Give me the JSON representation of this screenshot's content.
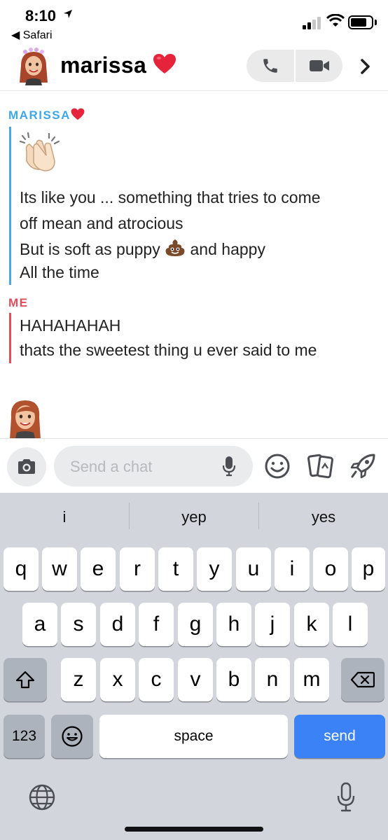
{
  "status_bar": {
    "time": "8:10",
    "back_app": "◀ Safari"
  },
  "header": {
    "contact_name": "marissa",
    "phone_icon": "phone-icon",
    "video_icon": "video-camera-icon",
    "chevron_icon": "chevron-right-icon"
  },
  "conversation": {
    "blocks": [
      {
        "sender": "MARISSA",
        "color": "#3ea6ea",
        "lines": [
          "Its like you ... something that tries to come",
          "off mean and atrocious",
          "But is soft as puppy",
          "and happy",
          "All the time"
        ]
      },
      {
        "sender": "ME",
        "color": "#e34c5a",
        "lines": [
          "HAHAHAHAH",
          "thats the sweetest thing u ever said to me"
        ]
      }
    ]
  },
  "input_bar": {
    "placeholder": "Send a chat"
  },
  "keyboard": {
    "suggestions": [
      "i",
      "yep",
      "yes"
    ],
    "row1": [
      "q",
      "w",
      "e",
      "r",
      "t",
      "y",
      "u",
      "i",
      "o",
      "p"
    ],
    "row2": [
      "a",
      "s",
      "d",
      "f",
      "g",
      "h",
      "j",
      "k",
      "l"
    ],
    "row3": [
      "z",
      "x",
      "c",
      "v",
      "b",
      "n",
      "m"
    ],
    "numbers_key": "123",
    "space_key": "space",
    "send_key": "send"
  },
  "colors": {
    "accent_blue": "#3ea6ea",
    "accent_red": "#e34c5a",
    "send_key": "#3b82f6"
  }
}
